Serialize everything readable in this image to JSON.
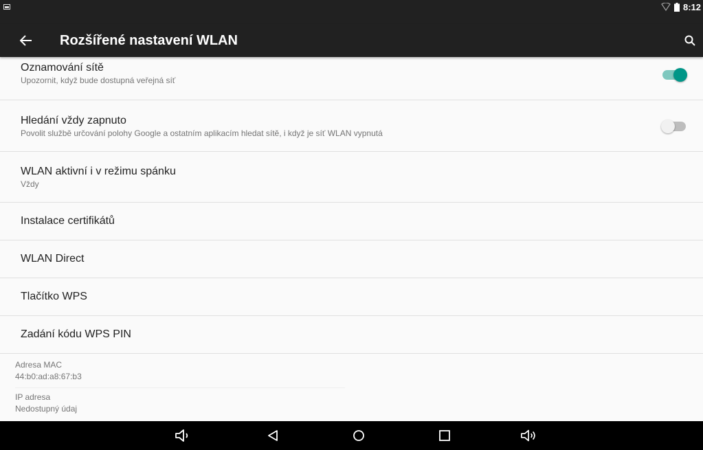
{
  "status_bar": {
    "time": "8:12",
    "icons": [
      "image-notification-icon",
      "wifi-icon",
      "battery-icon"
    ]
  },
  "toolbar": {
    "title": "Rozšířené nastavení WLAN",
    "back_icon": "arrow-back-icon",
    "search_icon": "search-icon"
  },
  "settings": {
    "network_notification": {
      "title": "Oznamování sítě",
      "summary": "Upozornit, když bude dostupná veřejná síť",
      "enabled": true
    },
    "scanning_always": {
      "title": "Hledání vždy zapnuto",
      "summary": "Povolit službě určování polohy Google a ostatním aplikacím hledat sítě, i když je síť WLAN vypnutá",
      "enabled": false
    },
    "wifi_sleep": {
      "title": "WLAN aktivní i v režimu spánku",
      "summary": "Vždy"
    },
    "install_certificates": {
      "title": "Instalace certifikátů"
    },
    "wlan_direct": {
      "title": "WLAN Direct"
    },
    "wps_button": {
      "title": "Tlačítko WPS"
    },
    "wps_pin": {
      "title": "Zadání kódu WPS PIN"
    }
  },
  "info": {
    "mac": {
      "label": "Adresa MAC",
      "value": "44:b0:ad:a8:67:b3"
    },
    "ip": {
      "label": "IP adresa",
      "value": "Nedostupný údaj"
    }
  },
  "nav_bar": {
    "buttons": [
      "volume-down-icon",
      "back-icon",
      "home-icon",
      "recents-icon",
      "volume-up-icon"
    ]
  },
  "colors": {
    "bar_background": "#212121",
    "accent": "#009688",
    "accent_track": "#7fc8bf",
    "background": "#fafafa"
  }
}
